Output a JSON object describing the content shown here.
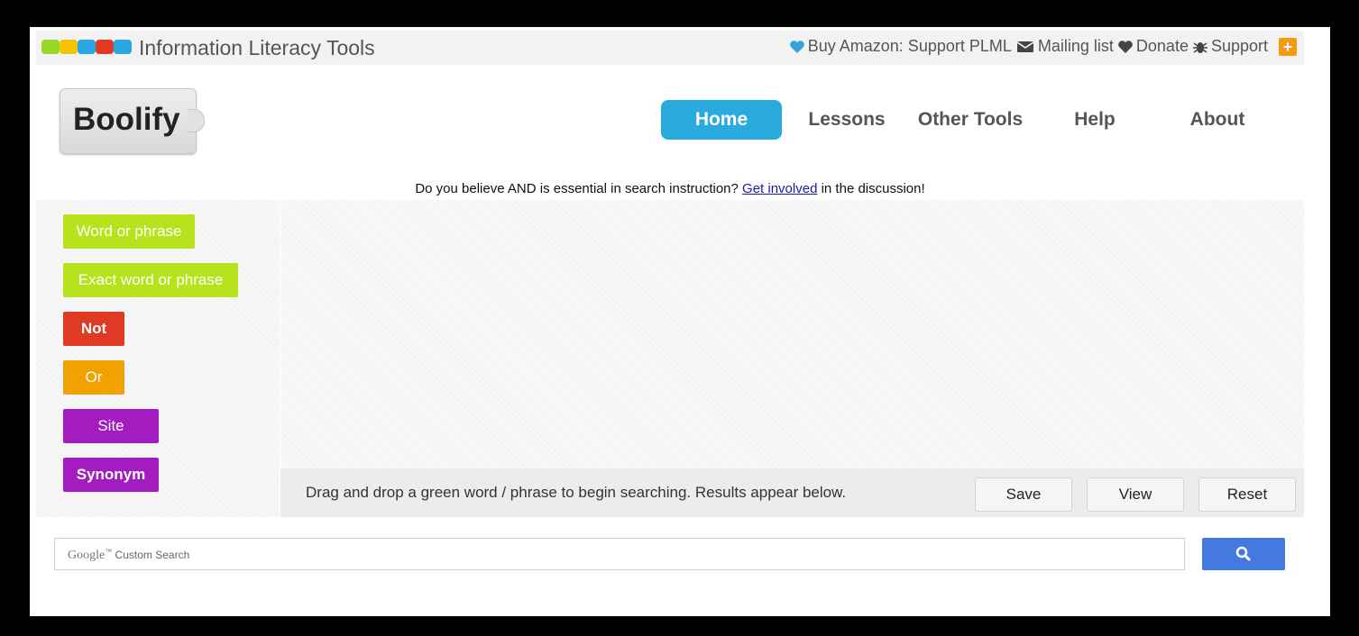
{
  "topbar": {
    "site_title": "Information Literacy Tools",
    "links": [
      {
        "label": "Buy Amazon: Support PLML",
        "icon": "heart-icon"
      },
      {
        "label": "Mailing list",
        "icon": "envelope-icon"
      },
      {
        "label": "Donate",
        "icon": "heart-icon"
      },
      {
        "label": "Support",
        "icon": "bug-icon"
      }
    ],
    "plus_icon": "+",
    "logo_colors": [
      "#9ad62a",
      "#f5c400",
      "#2aa7e0",
      "#e03a25",
      "#2aa7e0"
    ]
  },
  "header": {
    "logo_text": "Boolify",
    "nav": [
      {
        "label": "Home",
        "active": true
      },
      {
        "label": "Lessons"
      },
      {
        "label": "Other Tools"
      },
      {
        "label": "Help"
      },
      {
        "label": "About"
      }
    ]
  },
  "notice": {
    "before": "Do you believe AND is essential in search instruction? ",
    "link": "Get involved",
    "after": " in the discussion!"
  },
  "palette": {
    "chips": [
      {
        "label": "Word or phrase",
        "color": "#b6e31b"
      },
      {
        "label": "Exact word or phrase",
        "color": "#b6e31b"
      },
      {
        "label": "Not",
        "color": "#e03a25"
      },
      {
        "label": "Or",
        "color": "#f0a200"
      },
      {
        "label": "Site",
        "color": "#a21cc0"
      },
      {
        "label": "Synonym",
        "color": "#a21cc0"
      }
    ]
  },
  "actionbar": {
    "instructions": "Drag and drop a green word / phrase to begin searching. Results appear below.",
    "save_label": "Save",
    "view_label": "View",
    "reset_label": "Reset"
  },
  "search": {
    "placeholder_brand": "Google",
    "placeholder_tm": "™",
    "placeholder_text": " Custom Search",
    "button_icon": "search-icon",
    "button_color": "#4479e0"
  }
}
